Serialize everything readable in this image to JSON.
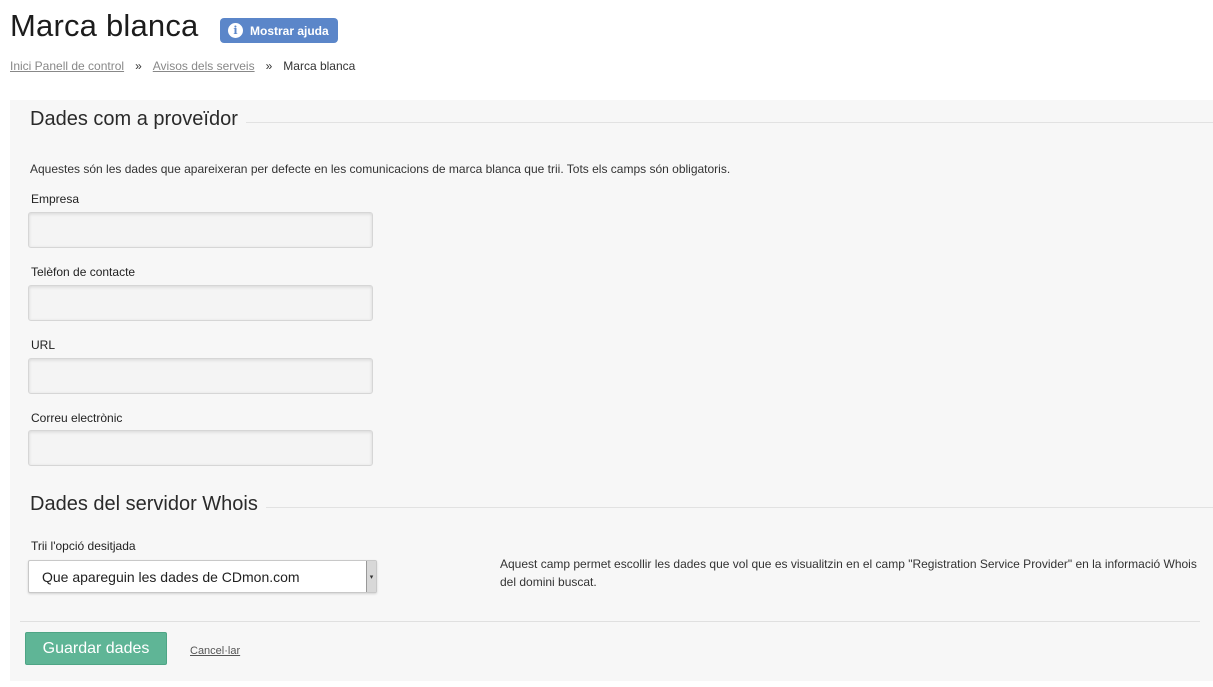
{
  "page": {
    "title": "Marca blanca",
    "help_button_label": "Mostrar ajuda"
  },
  "breadcrumb": {
    "items": [
      "Inici Panell de control",
      "Avisos dels serveis"
    ],
    "current": "Marca blanca",
    "separator": "»"
  },
  "provider_section": {
    "legend": "Dades com a proveïdor",
    "intro": "Aquestes són les dades que apareixeran per defecte en les comunicacions de marca blanca que trii. Tots els camps són obligatoris.",
    "fields": [
      {
        "label": "Empresa",
        "value": ""
      },
      {
        "label": "Telèfon de contacte",
        "value": ""
      },
      {
        "label": "URL",
        "value": ""
      },
      {
        "label": "Correu electrònic",
        "value": ""
      }
    ]
  },
  "whois_section": {
    "legend": "Dades del servidor Whois",
    "select_label": "Trii l'opció desitjada",
    "select_value": "Que apareguin les dades de CDmon.com",
    "help_text": "Aquest camp permet escollir les dades que vol que es visualitzin en el camp \"Registration Service Provider\" en la informació Whois del domini buscat."
  },
  "actions": {
    "save_label": "Guardar dades",
    "cancel_label": "Cancel·lar"
  },
  "icons": {
    "help": "info-icon",
    "select": "chevron-down-icon"
  },
  "colors": {
    "help_button": "#5b86c9",
    "save_button": "#5fb596",
    "panel_background": "#f7f7f7"
  }
}
